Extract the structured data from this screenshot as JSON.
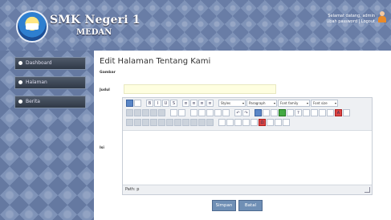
{
  "header": {
    "school_name": "SMK Negeri 1",
    "school_city": "MEDAN",
    "user_line1": "Selamat datang, admin",
    "user_line2": "Ubah password | Logout"
  },
  "sidebar": {
    "items": [
      {
        "label": "Dashboard",
        "icon": "circle-bullet-icon"
      },
      {
        "label": "Halaman",
        "icon": "circle-bullet-icon"
      },
      {
        "label": "Berita",
        "icon": "circle-bullet-icon"
      }
    ]
  },
  "content": {
    "page_title": "Edit Halaman Tentang Kami",
    "gambar_label": "Gambar",
    "judul_label": "Judul",
    "judul_value": "",
    "isi_label": "Isi",
    "editor": {
      "format_select": "Styles",
      "paragraph_select": "Paragraph",
      "font_select": "Font family",
      "size_select": "Font size",
      "status_path": "Path: p"
    },
    "save_label": "Simpan",
    "cancel_label": "Batal"
  },
  "colors": {
    "header_bg": "#7f93b8",
    "nav_item_bg": "#3b4556",
    "input_bg": "#fefee0",
    "button_bg": "#6f8fb5"
  }
}
